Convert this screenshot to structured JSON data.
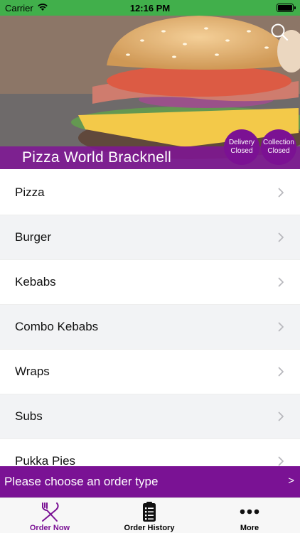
{
  "status_bar": {
    "carrier": "Carrier",
    "time": "12:16 PM"
  },
  "hero": {
    "brand_name": "Pizza World Bracknell",
    "search_icon": "search-icon",
    "delivery_status": {
      "line1": "Delivery",
      "line2": "Closed"
    },
    "collection_status": {
      "line1": "Collection",
      "line2": "Closed"
    }
  },
  "categories": [
    {
      "label": "Pizza"
    },
    {
      "label": "Burger"
    },
    {
      "label": "Kebabs"
    },
    {
      "label": "Combo Kebabs"
    },
    {
      "label": "Wraps"
    },
    {
      "label": "Subs"
    },
    {
      "label": "Pukka Pies"
    }
  ],
  "order_type_bar": {
    "text": "Please choose an order type",
    "arrow": ">"
  },
  "tabs": [
    {
      "label": "Order Now",
      "icon": "fork-knife-icon"
    },
    {
      "label": "Order History",
      "icon": "clipboard-list-icon"
    },
    {
      "label": "More",
      "icon": "more-dots-icon"
    }
  ],
  "colors": {
    "status_bar": "#41af4b",
    "brand_purple": "#7a1294",
    "row_alt": "#f2f3f5"
  }
}
